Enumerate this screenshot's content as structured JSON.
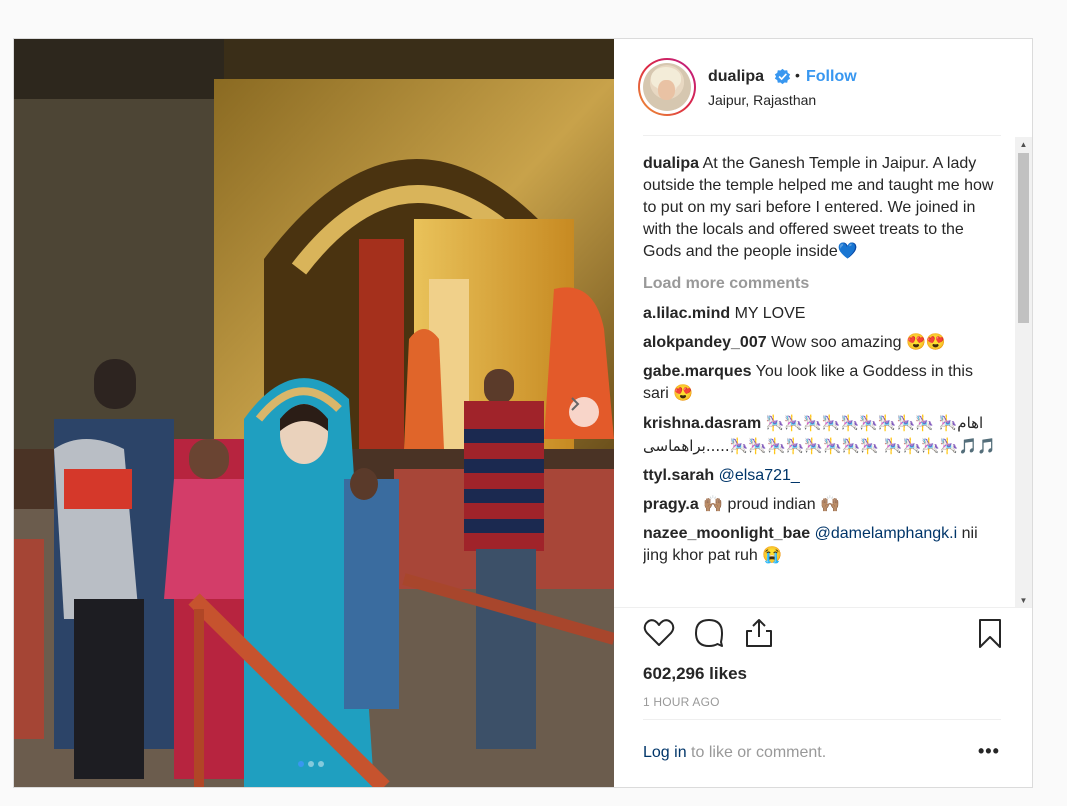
{
  "post": {
    "username": "dualipa",
    "follow_label": "Follow",
    "separator": "•",
    "location": "Jaipur, Rajasthan",
    "caption": "At the Ganesh Temple in Jaipur. A lady outside the temple helped me and taught me how to put on my sari before I entered. We joined in with the locals and offered sweet treats to the Gods and the people inside💙",
    "load_more_label": "Load more comments",
    "comments": [
      {
        "user": "a.lilac.mind",
        "text": "MY LOVE"
      },
      {
        "user": "alokpandey_007",
        "text": "Wow soo amazing 😍😍"
      },
      {
        "user": "gabe.marques",
        "text": "You look like a Goddess in this sari 😍"
      },
      {
        "user": "krishna.dasram",
        "text": "🎠🎠🎠🎠🎠🎠🎠🎠🎠 🎠اهام براهماسی.....🎠🎠🎠🎠🎠🎠🎠🎠 🎠🎠🎠🎠🎵🎵"
      },
      {
        "user": "ttyl.sarah",
        "mention": "@elsa721_"
      },
      {
        "user": "pragy.a",
        "text": "🙌🏽 proud indian 🙌🏽"
      },
      {
        "user": "nazee_moonlight_bae",
        "mention": "@damelamphangk.i",
        "text": "nii jing khor pat ruh 😭"
      }
    ],
    "likes": "602,296 likes",
    "time": "1 HOUR AGO",
    "login_link": "Log in",
    "login_rest": " to like or comment.",
    "more_label": "•••"
  },
  "icons": {
    "like": "heart-icon",
    "comment": "comment-icon",
    "share": "share-icon",
    "save": "bookmark-icon",
    "verified": "verified-badge-icon",
    "next": "chevron-right-icon"
  },
  "colors": {
    "accent": "#3897f0",
    "link": "#003569",
    "muted": "#999999"
  },
  "carousel": {
    "slides": 3,
    "active": 1
  }
}
